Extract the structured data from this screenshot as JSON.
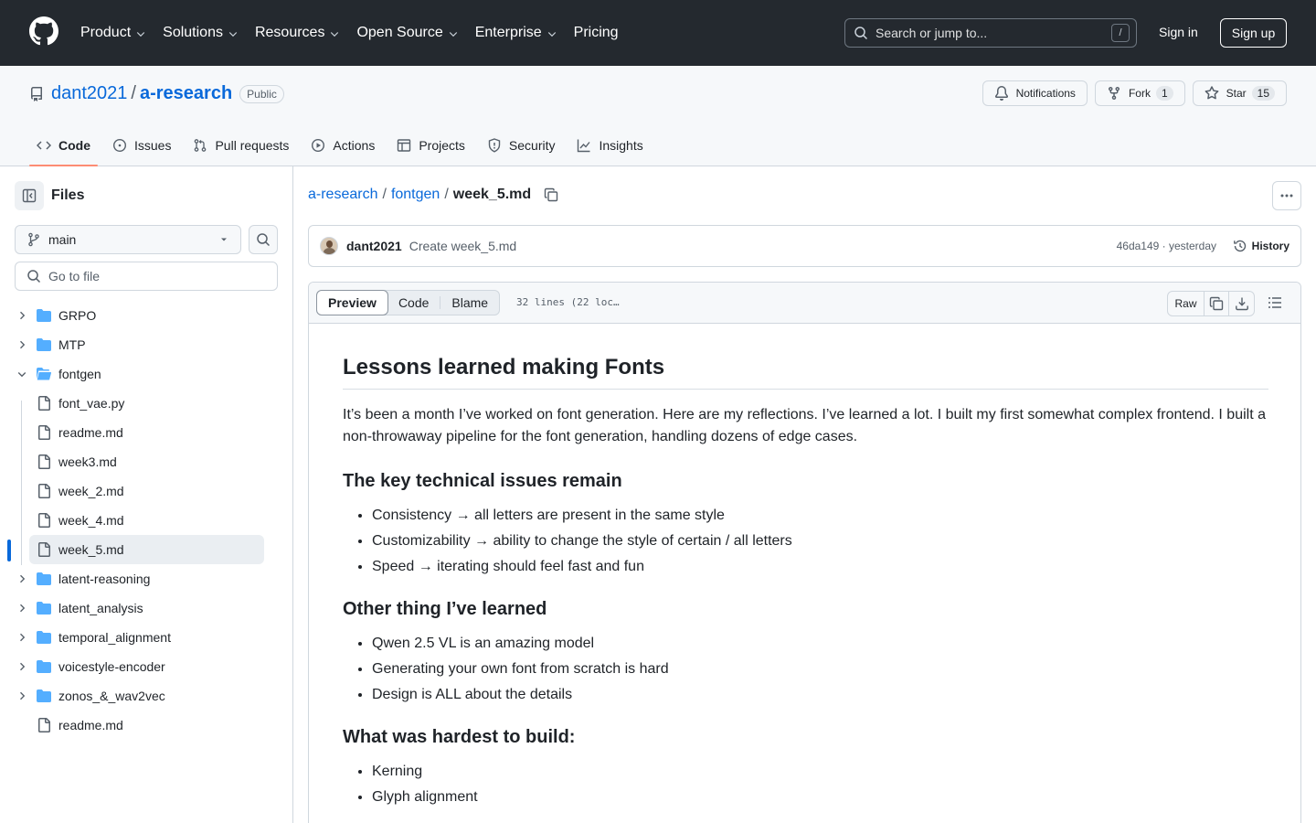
{
  "header": {
    "nav": [
      {
        "label": "Product",
        "has_dropdown": true
      },
      {
        "label": "Solutions",
        "has_dropdown": true
      },
      {
        "label": "Resources",
        "has_dropdown": true
      },
      {
        "label": "Open Source",
        "has_dropdown": true
      },
      {
        "label": "Enterprise",
        "has_dropdown": true
      },
      {
        "label": "Pricing",
        "has_dropdown": false
      }
    ],
    "search_placeholder": "Search or jump to...",
    "search_shortcut": "/",
    "sign_in": "Sign in",
    "sign_up": "Sign up"
  },
  "repo": {
    "owner": "dant2021",
    "separator": "/",
    "name": "a-research",
    "visibility": "Public",
    "notifications_label": "Notifications",
    "fork_label": "Fork",
    "fork_count": "1",
    "star_label": "Star",
    "star_count": "15",
    "tabs": [
      {
        "label": "Code",
        "icon": "code-icon",
        "active": true
      },
      {
        "label": "Issues",
        "icon": "issue-icon",
        "active": false
      },
      {
        "label": "Pull requests",
        "icon": "pull-request-icon",
        "active": false
      },
      {
        "label": "Actions",
        "icon": "play-icon",
        "active": false
      },
      {
        "label": "Projects",
        "icon": "table-icon",
        "active": false
      },
      {
        "label": "Security",
        "icon": "shield-icon",
        "active": false
      },
      {
        "label": "Insights",
        "icon": "graph-icon",
        "active": false
      }
    ]
  },
  "sidebar": {
    "title": "Files",
    "branch": "main",
    "goto_placeholder": "Go to file",
    "tree": [
      {
        "name": "GRPO",
        "type": "folder",
        "expanded": false,
        "depth": 0
      },
      {
        "name": "MTP",
        "type": "folder",
        "expanded": false,
        "depth": 0
      },
      {
        "name": "fontgen",
        "type": "folder",
        "expanded": true,
        "depth": 0
      },
      {
        "name": "font_vae.py",
        "type": "file",
        "depth": 1
      },
      {
        "name": "readme.md",
        "type": "file",
        "depth": 1
      },
      {
        "name": "week3.md",
        "type": "file",
        "depth": 1
      },
      {
        "name": "week_2.md",
        "type": "file",
        "depth": 1
      },
      {
        "name": "week_4.md",
        "type": "file",
        "depth": 1
      },
      {
        "name": "week_5.md",
        "type": "file",
        "depth": 1,
        "selected": true
      },
      {
        "name": "latent-reasoning",
        "type": "folder",
        "expanded": false,
        "depth": 0
      },
      {
        "name": "latent_analysis",
        "type": "folder",
        "expanded": false,
        "depth": 0
      },
      {
        "name": "temporal_alignment",
        "type": "folder",
        "expanded": false,
        "depth": 0
      },
      {
        "name": "voicestyle-encoder",
        "type": "folder",
        "expanded": false,
        "depth": 0
      },
      {
        "name": "zonos_&_wav2vec",
        "type": "folder",
        "expanded": false,
        "depth": 0
      },
      {
        "name": "readme.md",
        "type": "file",
        "depth": 0
      }
    ]
  },
  "breadcrumb": {
    "repo": "a-research",
    "folder": "fontgen",
    "file": "week_5.md",
    "sep": "/"
  },
  "commit": {
    "author": "dant2021",
    "message": "Create week_5.md",
    "meta": "46da149 · yesterday",
    "history_label": "History"
  },
  "file": {
    "view_tabs": [
      "Preview",
      "Code",
      "Blame"
    ],
    "active_view": "Preview",
    "lines_info": "32 lines (22 loc…",
    "raw_label": "Raw"
  },
  "markdown": {
    "h1": "Lessons learned making Fonts",
    "intro": "It’s been a month I’ve worked on font generation. Here are my reflections. I’ve learned a lot. I built my first somewhat complex frontend. I built a non-throwaway pipeline for the font generation, handling dozens of edge cases.",
    "sections": [
      {
        "heading": "The key technical issues remain",
        "items": [
          "Consistency → all letters are present in the same style",
          "Customizability → ability to change the style of certain / all letters",
          "Speed → iterating should feel fast and fun"
        ]
      },
      {
        "heading": "Other thing I’ve learned",
        "items": [
          "Qwen 2.5 VL is an amazing model",
          "Generating your own font from scratch is hard",
          "Design is ALL about the details"
        ]
      },
      {
        "heading": "What was hardest to build:",
        "items": [
          "Kerning",
          "Glyph alignment"
        ]
      }
    ]
  },
  "colors": {
    "header_bg": "#24292f",
    "link": "#0969da",
    "active_tab_underline": "#fd8c73",
    "folder": "#54aeff"
  }
}
